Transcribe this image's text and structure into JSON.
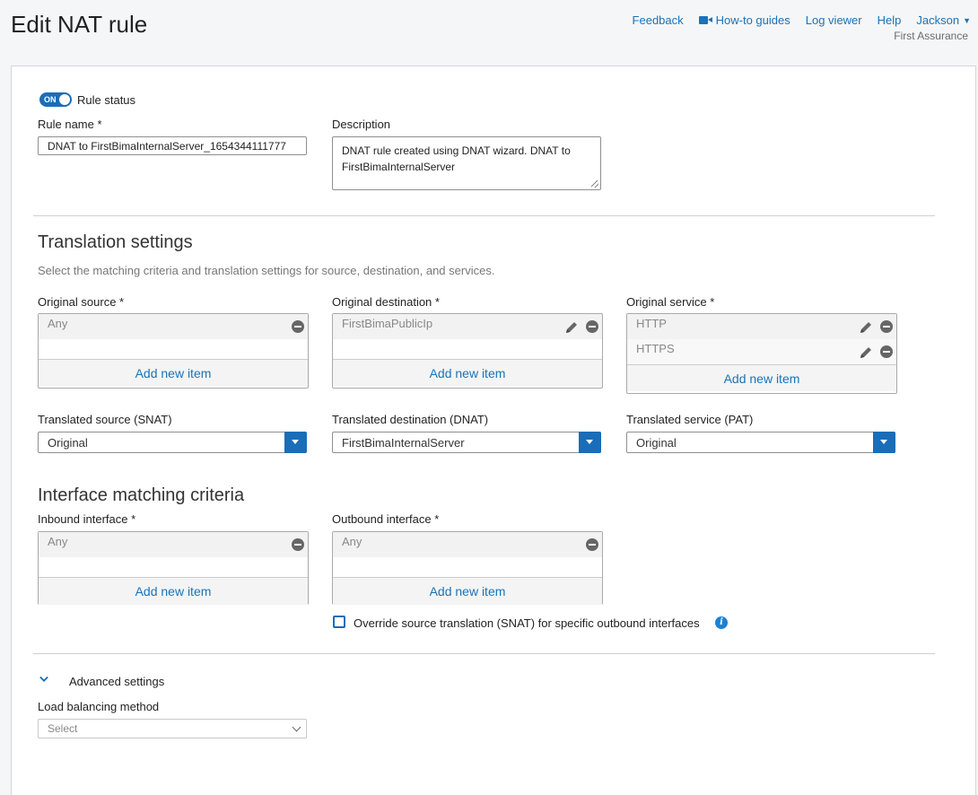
{
  "page": {
    "title": "Edit NAT rule"
  },
  "topnav": {
    "feedback": "Feedback",
    "howto": "How-to guides",
    "logviewer": "Log viewer",
    "help": "Help",
    "user": "Jackson",
    "org": "First Assurance"
  },
  "form": {
    "rule_status_toggle": "ON",
    "rule_status_label": "Rule status",
    "rule_name_label": "Rule name *",
    "rule_name_value": "DNAT to FirstBimaInternalServer_1654344111777",
    "description_label": "Description",
    "description_value": "DNAT rule created using DNAT wizard. DNAT to FirstBimaInternalServer"
  },
  "translation": {
    "title": "Translation settings",
    "hint": "Select the matching criteria and translation settings for source, destination, and services.",
    "orig_source_label": "Original source *",
    "orig_source_items": [
      "Any"
    ],
    "orig_dest_label": "Original destination *",
    "orig_dest_items": [
      "FirstBimaPublicIp"
    ],
    "orig_service_label": "Original service *",
    "orig_service_items": [
      "HTTP",
      "HTTPS"
    ],
    "add_new_item": "Add new item",
    "trans_source_label": "Translated source (SNAT)",
    "trans_source_value": "Original",
    "trans_dest_label": "Translated destination (DNAT)",
    "trans_dest_value": "FirstBimaInternalServer",
    "trans_service_label": "Translated service (PAT)",
    "trans_service_value": "Original"
  },
  "interface": {
    "title": "Interface matching criteria",
    "inbound_label": "Inbound interface *",
    "inbound_items": [
      "Any"
    ],
    "outbound_label": "Outbound interface *",
    "outbound_items": [
      "Any"
    ],
    "add_new_item": "Add new item",
    "override_label": "Override source translation (SNAT) for specific outbound interfaces"
  },
  "advanced": {
    "title": "Advanced settings",
    "lb_label": "Load balancing method",
    "lb_placeholder": "Select"
  }
}
